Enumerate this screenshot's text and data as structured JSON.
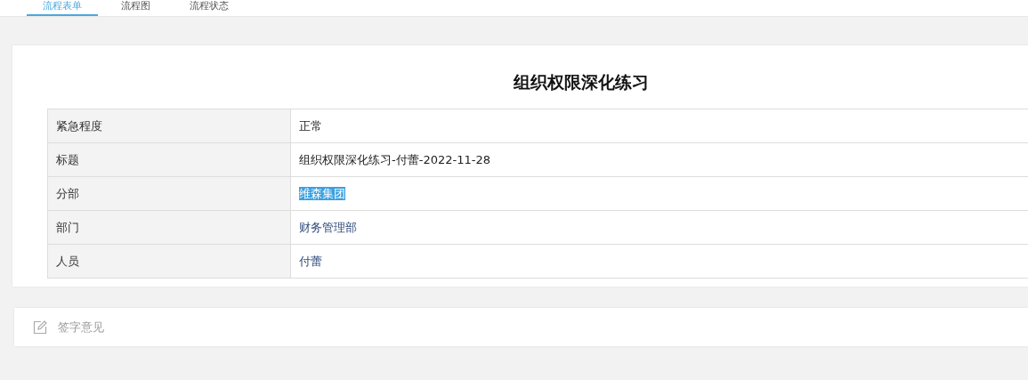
{
  "tabs": [
    {
      "label": "流程表单",
      "selected": true
    },
    {
      "label": "流程图",
      "selected": false
    },
    {
      "label": "流程状态",
      "selected": false
    }
  ],
  "form": {
    "title": "组织权限深化练习",
    "rows": [
      {
        "label": "紧急程度",
        "value": "正常",
        "link": false,
        "highlighted": false
      },
      {
        "label": "标题",
        "value": "组织权限深化练习-付蕾-2022-11-28",
        "link": false,
        "highlighted": false
      },
      {
        "label": "分部",
        "value": "维森集团",
        "link": true,
        "highlighted": true
      },
      {
        "label": "部门",
        "value": "财务管理部",
        "link": true,
        "highlighted": false
      },
      {
        "label": "人员",
        "value": "付蕾",
        "link": true,
        "highlighted": false
      }
    ]
  },
  "signature": {
    "label": "签字意见"
  }
}
